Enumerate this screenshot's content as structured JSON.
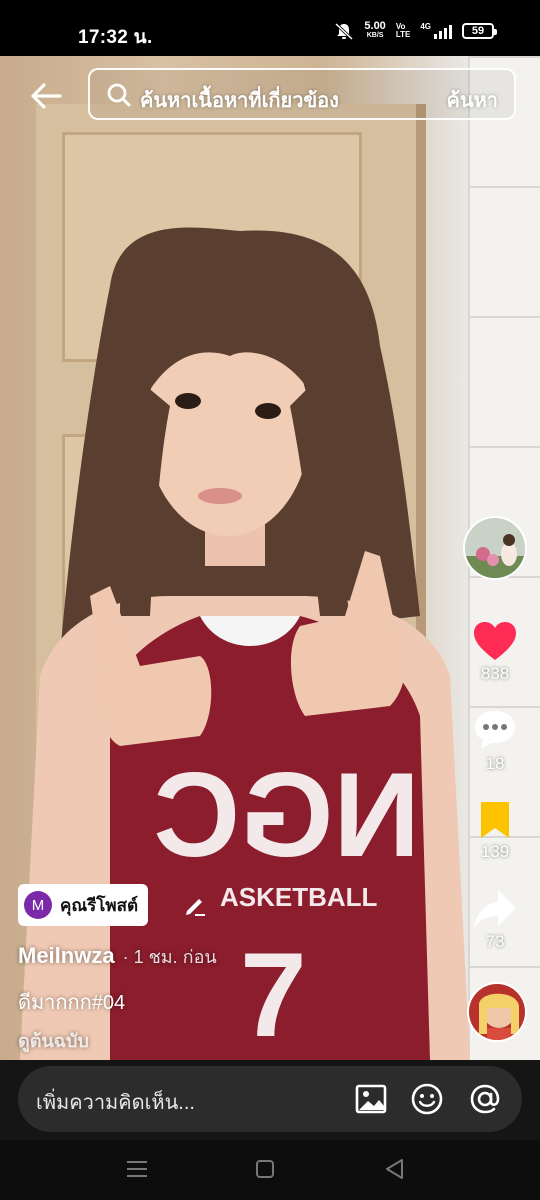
{
  "status_bar": {
    "time": "17:32 น.",
    "net_speed": "5.00",
    "net_unit": "KB/S",
    "volte_top": "Vo",
    "volte_bottom": "LTE",
    "network": "4G",
    "battery": "59"
  },
  "search": {
    "placeholder": "ค้นหาเนื้อหาที่เกี่ยวข้อง",
    "button": "ค้นหา"
  },
  "actions": {
    "likes": "838",
    "comments": "18",
    "saves": "139",
    "shares": "73"
  },
  "post": {
    "repost_initial": "M",
    "repost_label": "คุณรีโพสต์",
    "username": "Meilnwza",
    "time": "· 1 ชม. ก่อน",
    "caption": "ดีมากกก#04",
    "see_translation": "ดูต้นฉบับ"
  },
  "comment_bar": {
    "placeholder": "เพิ่มความคิดเห็น..."
  },
  "colors": {
    "like": "#fe2c55",
    "save": "#fcc400",
    "repost_avatar": "#7a2aa8"
  }
}
